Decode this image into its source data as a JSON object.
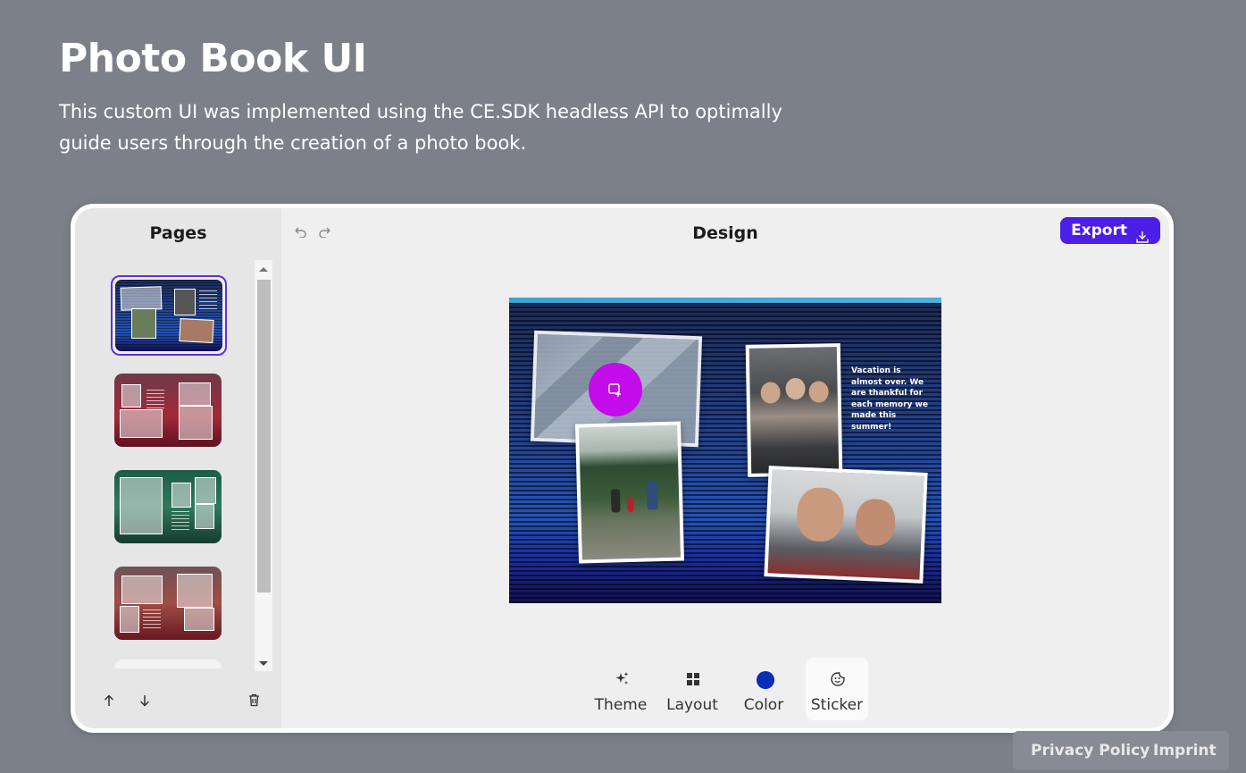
{
  "header": {
    "title": "Photo Book UI",
    "description": "This custom UI was implemented using the CE.SDK headless API to optimally guide users through the creation of a photo book."
  },
  "pages_panel": {
    "title": "Pages",
    "pages": [
      {
        "theme": "blue",
        "selected": true
      },
      {
        "theme": "red",
        "selected": false
      },
      {
        "theme": "green",
        "selected": false
      },
      {
        "theme": "brown",
        "selected": false
      }
    ],
    "tools": {
      "move_up_icon": "arrow-up-icon",
      "move_down_icon": "arrow-down-icon",
      "delete_icon": "trash-icon"
    }
  },
  "main": {
    "title": "Design",
    "undo_icon": "undo-icon",
    "redo_icon": "redo-icon",
    "export_label": "Export",
    "export_icon": "download-icon",
    "canvas": {
      "text": "Vacation is almost over. We are thankful for each memory we made this summer!",
      "add_image_icon": "add-image-icon",
      "accent_color": "#c40bea"
    },
    "toolbar": [
      {
        "label": "Theme",
        "icon": "sparkle-icon",
        "active": false
      },
      {
        "label": "Layout",
        "icon": "grid-icon",
        "active": false
      },
      {
        "label": "Color",
        "icon": "color-dot-icon",
        "active": false,
        "color": "#0a2db8"
      },
      {
        "label": "Sticker",
        "icon": "sticker-icon",
        "active": true
      }
    ]
  },
  "footer": {
    "privacy": "Privacy Policy",
    "imprint": "Imprint"
  },
  "colors": {
    "background": "#7b8089",
    "accent": "#4b1fe8"
  }
}
